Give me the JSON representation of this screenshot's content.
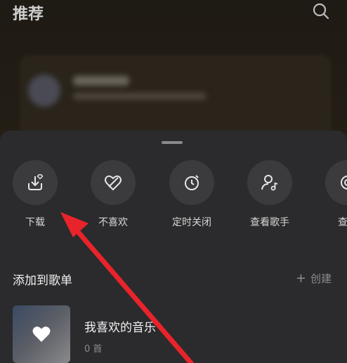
{
  "header": {
    "title": "推荐"
  },
  "actions": [
    {
      "label": "下载",
      "icon": "download-icon"
    },
    {
      "label": "不喜欢",
      "icon": "dislike-heart-icon"
    },
    {
      "label": "定时关闭",
      "icon": "timer-icon"
    },
    {
      "label": "查看歌手",
      "icon": "singer-icon"
    },
    {
      "label": "查看",
      "icon": "more-icon"
    }
  ],
  "playlists_section": {
    "title": "添加到歌单",
    "create_label": "创建"
  },
  "playlist": {
    "name": "我喜欢的音乐",
    "count": "0 首"
  },
  "colors": {
    "sheet_bg": "#2b2b2d",
    "annotation_arrow": "#e8242a"
  }
}
